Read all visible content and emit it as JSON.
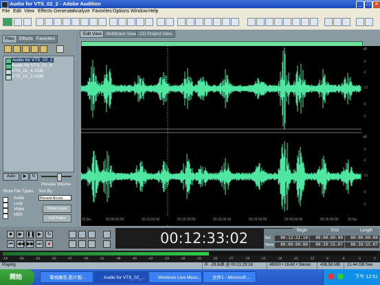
{
  "window": {
    "title": "Audio for VTS_02_2 - Adobe Audition",
    "min": "_",
    "max": "□",
    "close": "✕"
  },
  "menu": [
    "File",
    "Edit",
    "View",
    "Effects",
    "Generate",
    "Analyze",
    "Favorites",
    "Options",
    "Window",
    "Help"
  ],
  "left_tabs": [
    "Files",
    "Effects",
    "Favorites"
  ],
  "files": [
    "Audio for VTS_02_2",
    "Audio for VTS_02_4",
    "VTS_02_4.VOB",
    "VTS_02_2.VOB"
  ],
  "autoplay_label": "Auto",
  "preview_label": "Preview Volume",
  "show_types_label": "Show File Types:",
  "sort_by_label": "Sort By:",
  "sort_value": "Recent Acces",
  "file_types": [
    "Audio",
    "Loop",
    "Video",
    "MIDI"
  ],
  "left_buttons": [
    "Show Cues",
    "Full Paths"
  ],
  "main_tabs": [
    "Edit View",
    "Multitrack View",
    "CD Project View"
  ],
  "db_labels": [
    "dB",
    "-3",
    "-6",
    "-10",
    "-6",
    "-3",
    "dB",
    "-3",
    "-6",
    "-10",
    "-6",
    "-3"
  ],
  "time_ruler": [
    "30 fps",
    "00:05:00:00",
    "00:10:00:00",
    "00:15:00:00",
    "00:20:00:00",
    "00:25:00:00",
    "00:30:00:00",
    "00:35:00:00",
    "30 fps"
  ],
  "time_display": "00:12:33:02",
  "selection": {
    "headers": [
      "Begin",
      "End",
      "Length"
    ],
    "row_labels": [
      "Sel",
      "View"
    ],
    "sel": [
      "00:12:22:10",
      "00:00:00:00",
      "00:00:00:00"
    ],
    "view": [
      "00:00:00:00",
      "00:39:55:07",
      "00:39:55:07"
    ]
  },
  "meter_labels": [
    "-69",
    "-66",
    "-63",
    "-60",
    "-57",
    "-54",
    "-51",
    "-48",
    "-45",
    "-42",
    "-39",
    "-36",
    "-33",
    "-30",
    "-27",
    "-24",
    "-21",
    "-18",
    "-15",
    "-12",
    "-9",
    "-6",
    "-3",
    "0"
  ],
  "meter_level": 0.55,
  "status": [
    "Playing",
    "R: -28.6dB @ 00:21:29:18",
    "48000 • 16-bit • Stereo",
    "438.58 MB",
    "21.44 GB free"
  ],
  "taskbar": {
    "start": "開始",
    "tasks": [
      "電視廣告,影片製...",
      "Audio for VTS_02_...",
      "Windows Live Mess...",
      "文件1 - Microsoft ..."
    ],
    "clock": "下午 12:51"
  },
  "colors": {
    "wave": "#4fe6a2",
    "accent": "#3168d5",
    "overview": "#6fe0a0"
  }
}
